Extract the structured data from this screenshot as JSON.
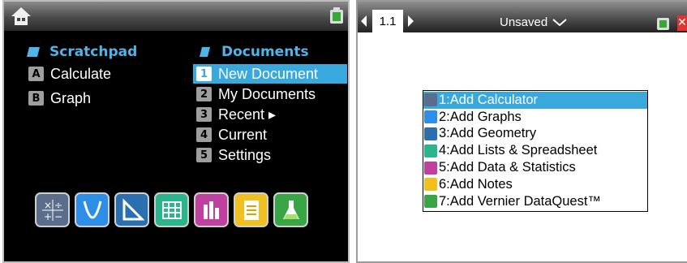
{
  "left": {
    "scratchpad": {
      "title": "Scratchpad",
      "items": [
        {
          "key": "A",
          "label": "Calculate"
        },
        {
          "key": "B",
          "label": "Graph"
        }
      ]
    },
    "documents": {
      "title": "Documents",
      "items": [
        {
          "key": "1",
          "label": "New Document"
        },
        {
          "key": "2",
          "label": "My Documents"
        },
        {
          "key": "3",
          "label": "Recent ▸"
        },
        {
          "key": "4",
          "label": "Current"
        },
        {
          "key": "5",
          "label": "Settings"
        }
      ]
    },
    "apps": [
      "calculator-app",
      "graphs-app",
      "geometry-app",
      "lists-spreadsheet-app",
      "data-statistics-app",
      "notes-app",
      "vernier-dataquest-app"
    ]
  },
  "right": {
    "tab_label": "1.1",
    "doc_title": "Unsaved",
    "close_label": "✕",
    "menu": [
      {
        "label": "1:Add Calculator",
        "icon": "calculator-icon",
        "color": "#5a6e8c"
      },
      {
        "label": "2:Add Graphs",
        "icon": "graphs-icon",
        "color": "#2c8ee6"
      },
      {
        "label": "3:Add Geometry",
        "icon": "geometry-icon",
        "color": "#2a6fb0"
      },
      {
        "label": "4:Add Lists & Spreadsheet",
        "icon": "spreadsheet-icon",
        "color": "#2bb58c"
      },
      {
        "label": "5:Add Data & Statistics",
        "icon": "statistics-icon",
        "color": "#c040a0"
      },
      {
        "label": "6:Add Notes",
        "icon": "notes-icon",
        "color": "#f0c020"
      },
      {
        "label": "7:Add Vernier DataQuest™",
        "icon": "vernier-icon",
        "color": "#3aa544"
      }
    ]
  },
  "colors": {
    "accent": "#39a8dc",
    "heading": "#4fb4e8",
    "background": "#000000"
  }
}
